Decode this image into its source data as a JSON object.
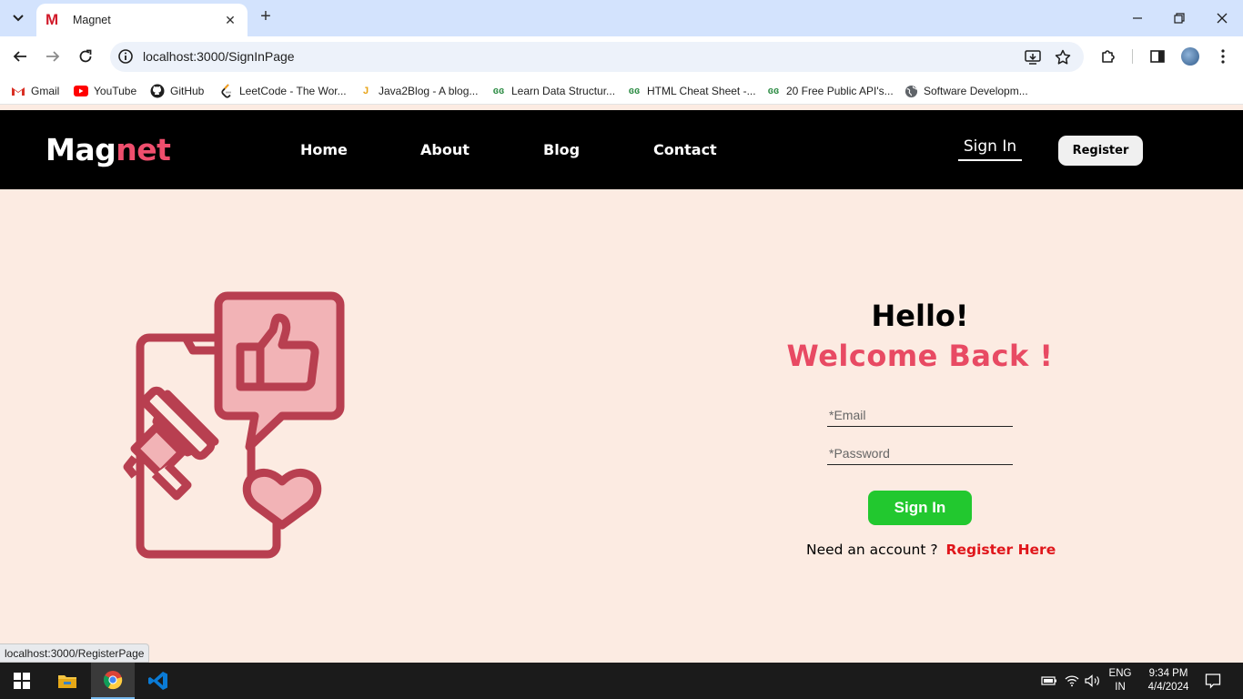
{
  "browser": {
    "tab_title": "Magnet",
    "url": "localhost:3000/SignInPage",
    "bookmarks": [
      {
        "label": "Gmail",
        "icon": "gmail-icon"
      },
      {
        "label": "YouTube",
        "icon": "youtube-icon"
      },
      {
        "label": "GitHub",
        "icon": "github-icon"
      },
      {
        "label": "LeetCode - The Wor...",
        "icon": "leetcode-icon"
      },
      {
        "label": "Java2Blog - A blog...",
        "icon": "java2blog-icon"
      },
      {
        "label": "Learn Data Structur...",
        "icon": "geeksforgeeks-icon"
      },
      {
        "label": "HTML Cheat Sheet -...",
        "icon": "geeksforgeeks-icon"
      },
      {
        "label": "20 Free Public API's...",
        "icon": "geeksforgeeks-icon"
      },
      {
        "label": "Software Developm...",
        "icon": "globe-icon"
      }
    ],
    "status_url": "localhost:3000/RegisterPage"
  },
  "site": {
    "logo_white": "Mag",
    "logo_pink": "net",
    "nav": [
      "Home",
      "About",
      "Blog",
      "Contact"
    ],
    "signin_label": "Sign In",
    "register_label": "Register"
  },
  "signin": {
    "hello": "Hello!",
    "welcome": "Welcome Back !",
    "email_placeholder": "*Email",
    "password_placeholder": "*Password",
    "button_label": "Sign In",
    "need_account": "Need an account ?",
    "register_here": "Register Here"
  },
  "taskbar": {
    "lang_top": "ENG",
    "lang_bottom": "IN",
    "time": "9:34 PM",
    "date": "4/4/2024"
  },
  "colors": {
    "accent_pink": "#e84a63",
    "page_bg": "#fcebe2",
    "signin_green": "#22c82f",
    "illustration": "#b83f50"
  }
}
